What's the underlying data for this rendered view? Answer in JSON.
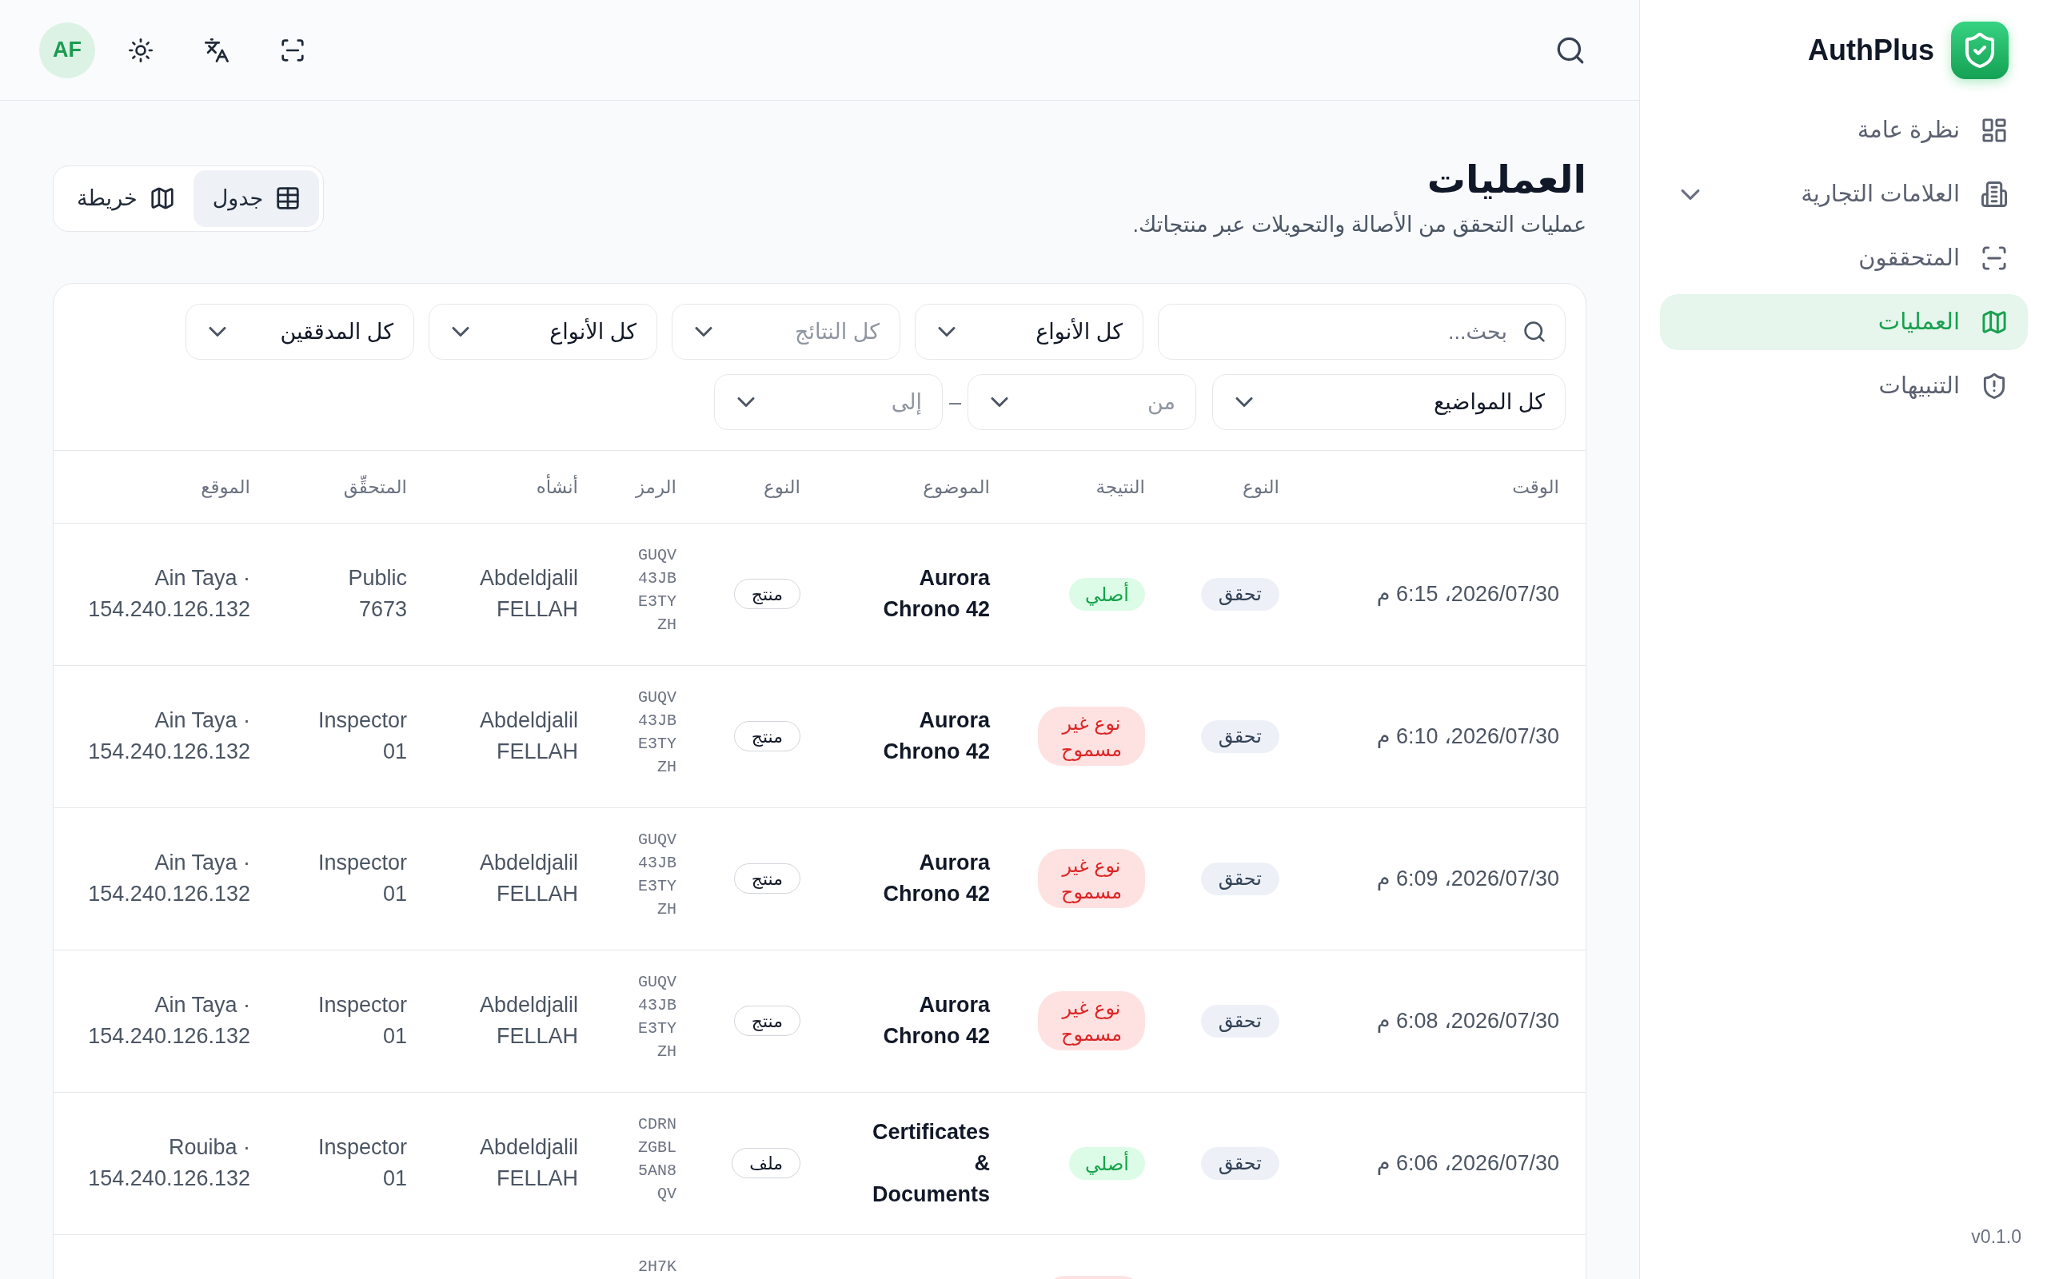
{
  "sidebar": {
    "brand": "AuthPlus",
    "items": [
      {
        "label": "نظرة عامة",
        "kind": "link",
        "selected": false
      },
      {
        "label": "العلامات التجارية",
        "kind": "group",
        "expanded": false,
        "selected": false
      },
      {
        "label": "المتحققون",
        "kind": "link",
        "selected": false
      },
      {
        "label": "العمليات",
        "kind": "link",
        "selected": true
      },
      {
        "label": "التنبيهات",
        "kind": "link",
        "selected": false
      }
    ],
    "version": "v0.1.0"
  },
  "top_bar": {
    "avatar": "AF"
  },
  "page": {
    "title": "العمليات",
    "subtitle": "عمليات التحقق من الأصالة والتحويلات عبر منتجاتك."
  },
  "view_toggle": [
    {
      "label": "جدول",
      "selected": true
    },
    {
      "label": "خريطة",
      "selected": false
    }
  ],
  "filters": {
    "search": {
      "placeholder": "بحث..."
    },
    "selects": [
      {
        "value": "كل الأنواع"
      },
      {
        "placeholder": "كل النتائج"
      },
      {
        "value": "كل الأنواع"
      },
      {
        "value": "كل المدققين"
      }
    ],
    "subject": {
      "value": "كل المواضيع"
    },
    "date_range": {
      "from": {
        "placeholder": "من"
      },
      "separator": "–",
      "to": {
        "placeholder": "إلى"
      }
    }
  },
  "table": {
    "columns": [
      "الوقت",
      "النوع",
      "النتيجة",
      "الموضوع",
      "النوع",
      "الرمز",
      "أنشأه",
      "المتحقِّق",
      "الموقع"
    ],
    "rows": [
      {
        "time": "2026/07/30، 6:15 م",
        "type": "تحقق",
        "result": {
          "label": "أصلي",
          "kind": "success"
        },
        "subject": "Aurora Chrono 42",
        "item_type": "منتج",
        "code": "GUQV43JBE3TYZH",
        "creator": "Abdeldjalil FELLAH",
        "verifier": "Public 7673",
        "location": "Ain Taya · 154.240.126.132"
      },
      {
        "time": "2026/07/30، 6:10 م",
        "type": "تحقق",
        "result": {
          "label": "نوع غير مسموح",
          "kind": "danger"
        },
        "subject": "Aurora Chrono 42",
        "item_type": "منتج",
        "code": "GUQV43JBE3TYZH",
        "creator": "Abdeldjalil FELLAH",
        "verifier": "Inspector 01",
        "location": "Ain Taya · 154.240.126.132"
      },
      {
        "time": "2026/07/30، 6:09 م",
        "type": "تحقق",
        "result": {
          "label": "نوع غير مسموح",
          "kind": "danger"
        },
        "subject": "Aurora Chrono 42",
        "item_type": "منتج",
        "code": "GUQV43JBE3TYZH",
        "creator": "Abdeldjalil FELLAH",
        "verifier": "Inspector 01",
        "location": "Ain Taya · 154.240.126.132"
      },
      {
        "time": "2026/07/30، 6:08 م",
        "type": "تحقق",
        "result": {
          "label": "نوع غير مسموح",
          "kind": "danger"
        },
        "subject": "Aurora Chrono 42",
        "item_type": "منتج",
        "code": "GUQV43JBE3TYZH",
        "creator": "Abdeldjalil FELLAH",
        "verifier": "Inspector 01",
        "location": "Ain Taya · 154.240.126.132"
      },
      {
        "time": "2026/07/30، 6:06 م",
        "type": "تحقق",
        "result": {
          "label": "أصلي",
          "kind": "success"
        },
        "subject": "Certificates & Documents",
        "item_type": "ملف",
        "code": "CDRNZGBL5AN8QV",
        "creator": "Abdeldjalil FELLAH",
        "verifier": "Inspector 01",
        "location": "Rouiba · 154.240.126.132"
      },
      {
        "code": "2H7K",
        "result": {
          "kind": "danger"
        }
      }
    ]
  }
}
